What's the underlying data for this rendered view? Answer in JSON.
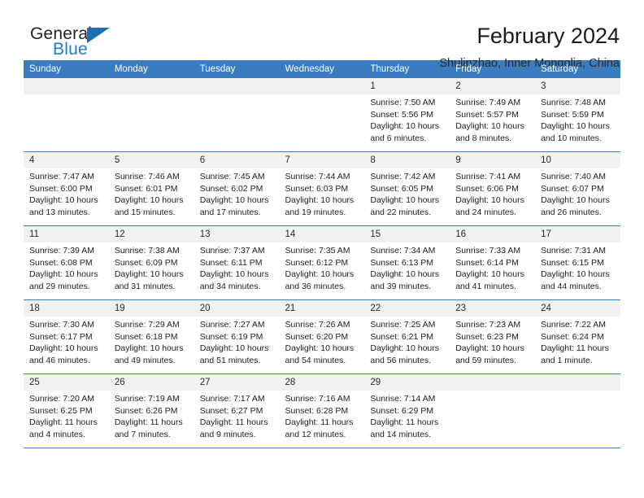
{
  "brand": {
    "name_part1": "General",
    "name_part2": "Blue",
    "accent_color": "#1f6fb4"
  },
  "header": {
    "title": "February 2024",
    "subtitle": "Shulinzhao, Inner Mongolia, China"
  },
  "theme": {
    "header_row_bg": "#3a7cc0",
    "daynum_bg": "#f1f1f1",
    "row_separator": "#3a7cc0"
  },
  "weekdays": [
    "Sunday",
    "Monday",
    "Tuesday",
    "Wednesday",
    "Thursday",
    "Friday",
    "Saturday"
  ],
  "weeks": [
    [
      {
        "day": "",
        "sunrise": "",
        "sunset": "",
        "daylight": "",
        "empty": true
      },
      {
        "day": "",
        "sunrise": "",
        "sunset": "",
        "daylight": "",
        "empty": true
      },
      {
        "day": "",
        "sunrise": "",
        "sunset": "",
        "daylight": "",
        "empty": true
      },
      {
        "day": "",
        "sunrise": "",
        "sunset": "",
        "daylight": "",
        "empty": true
      },
      {
        "day": "1",
        "sunrise": "Sunrise: 7:50 AM",
        "sunset": "Sunset: 5:56 PM",
        "daylight": "Daylight: 10 hours and 6 minutes."
      },
      {
        "day": "2",
        "sunrise": "Sunrise: 7:49 AM",
        "sunset": "Sunset: 5:57 PM",
        "daylight": "Daylight: 10 hours and 8 minutes."
      },
      {
        "day": "3",
        "sunrise": "Sunrise: 7:48 AM",
        "sunset": "Sunset: 5:59 PM",
        "daylight": "Daylight: 10 hours and 10 minutes."
      }
    ],
    [
      {
        "day": "4",
        "sunrise": "Sunrise: 7:47 AM",
        "sunset": "Sunset: 6:00 PM",
        "daylight": "Daylight: 10 hours and 13 minutes."
      },
      {
        "day": "5",
        "sunrise": "Sunrise: 7:46 AM",
        "sunset": "Sunset: 6:01 PM",
        "daylight": "Daylight: 10 hours and 15 minutes."
      },
      {
        "day": "6",
        "sunrise": "Sunrise: 7:45 AM",
        "sunset": "Sunset: 6:02 PM",
        "daylight": "Daylight: 10 hours and 17 minutes."
      },
      {
        "day": "7",
        "sunrise": "Sunrise: 7:44 AM",
        "sunset": "Sunset: 6:03 PM",
        "daylight": "Daylight: 10 hours and 19 minutes."
      },
      {
        "day": "8",
        "sunrise": "Sunrise: 7:42 AM",
        "sunset": "Sunset: 6:05 PM",
        "daylight": "Daylight: 10 hours and 22 minutes."
      },
      {
        "day": "9",
        "sunrise": "Sunrise: 7:41 AM",
        "sunset": "Sunset: 6:06 PM",
        "daylight": "Daylight: 10 hours and 24 minutes."
      },
      {
        "day": "10",
        "sunrise": "Sunrise: 7:40 AM",
        "sunset": "Sunset: 6:07 PM",
        "daylight": "Daylight: 10 hours and 26 minutes."
      }
    ],
    [
      {
        "day": "11",
        "sunrise": "Sunrise: 7:39 AM",
        "sunset": "Sunset: 6:08 PM",
        "daylight": "Daylight: 10 hours and 29 minutes."
      },
      {
        "day": "12",
        "sunrise": "Sunrise: 7:38 AM",
        "sunset": "Sunset: 6:09 PM",
        "daylight": "Daylight: 10 hours and 31 minutes."
      },
      {
        "day": "13",
        "sunrise": "Sunrise: 7:37 AM",
        "sunset": "Sunset: 6:11 PM",
        "daylight": "Daylight: 10 hours and 34 minutes."
      },
      {
        "day": "14",
        "sunrise": "Sunrise: 7:35 AM",
        "sunset": "Sunset: 6:12 PM",
        "daylight": "Daylight: 10 hours and 36 minutes."
      },
      {
        "day": "15",
        "sunrise": "Sunrise: 7:34 AM",
        "sunset": "Sunset: 6:13 PM",
        "daylight": "Daylight: 10 hours and 39 minutes."
      },
      {
        "day": "16",
        "sunrise": "Sunrise: 7:33 AM",
        "sunset": "Sunset: 6:14 PM",
        "daylight": "Daylight: 10 hours and 41 minutes."
      },
      {
        "day": "17",
        "sunrise": "Sunrise: 7:31 AM",
        "sunset": "Sunset: 6:15 PM",
        "daylight": "Daylight: 10 hours and 44 minutes."
      }
    ],
    [
      {
        "day": "18",
        "sunrise": "Sunrise: 7:30 AM",
        "sunset": "Sunset: 6:17 PM",
        "daylight": "Daylight: 10 hours and 46 minutes."
      },
      {
        "day": "19",
        "sunrise": "Sunrise: 7:29 AM",
        "sunset": "Sunset: 6:18 PM",
        "daylight": "Daylight: 10 hours and 49 minutes."
      },
      {
        "day": "20",
        "sunrise": "Sunrise: 7:27 AM",
        "sunset": "Sunset: 6:19 PM",
        "daylight": "Daylight: 10 hours and 51 minutes."
      },
      {
        "day": "21",
        "sunrise": "Sunrise: 7:26 AM",
        "sunset": "Sunset: 6:20 PM",
        "daylight": "Daylight: 10 hours and 54 minutes."
      },
      {
        "day": "22",
        "sunrise": "Sunrise: 7:25 AM",
        "sunset": "Sunset: 6:21 PM",
        "daylight": "Daylight: 10 hours and 56 minutes."
      },
      {
        "day": "23",
        "sunrise": "Sunrise: 7:23 AM",
        "sunset": "Sunset: 6:23 PM",
        "daylight": "Daylight: 10 hours and 59 minutes."
      },
      {
        "day": "24",
        "sunrise": "Sunrise: 7:22 AM",
        "sunset": "Sunset: 6:24 PM",
        "daylight": "Daylight: 11 hours and 1 minute."
      }
    ],
    [
      {
        "day": "25",
        "sunrise": "Sunrise: 7:20 AM",
        "sunset": "Sunset: 6:25 PM",
        "daylight": "Daylight: 11 hours and 4 minutes."
      },
      {
        "day": "26",
        "sunrise": "Sunrise: 7:19 AM",
        "sunset": "Sunset: 6:26 PM",
        "daylight": "Daylight: 11 hours and 7 minutes."
      },
      {
        "day": "27",
        "sunrise": "Sunrise: 7:17 AM",
        "sunset": "Sunset: 6:27 PM",
        "daylight": "Daylight: 11 hours and 9 minutes."
      },
      {
        "day": "28",
        "sunrise": "Sunrise: 7:16 AM",
        "sunset": "Sunset: 6:28 PM",
        "daylight": "Daylight: 11 hours and 12 minutes."
      },
      {
        "day": "29",
        "sunrise": "Sunrise: 7:14 AM",
        "sunset": "Sunset: 6:29 PM",
        "daylight": "Daylight: 11 hours and 14 minutes."
      },
      {
        "day": "",
        "sunrise": "",
        "sunset": "",
        "daylight": "",
        "empty": true
      },
      {
        "day": "",
        "sunrise": "",
        "sunset": "",
        "daylight": "",
        "empty": true
      }
    ]
  ]
}
